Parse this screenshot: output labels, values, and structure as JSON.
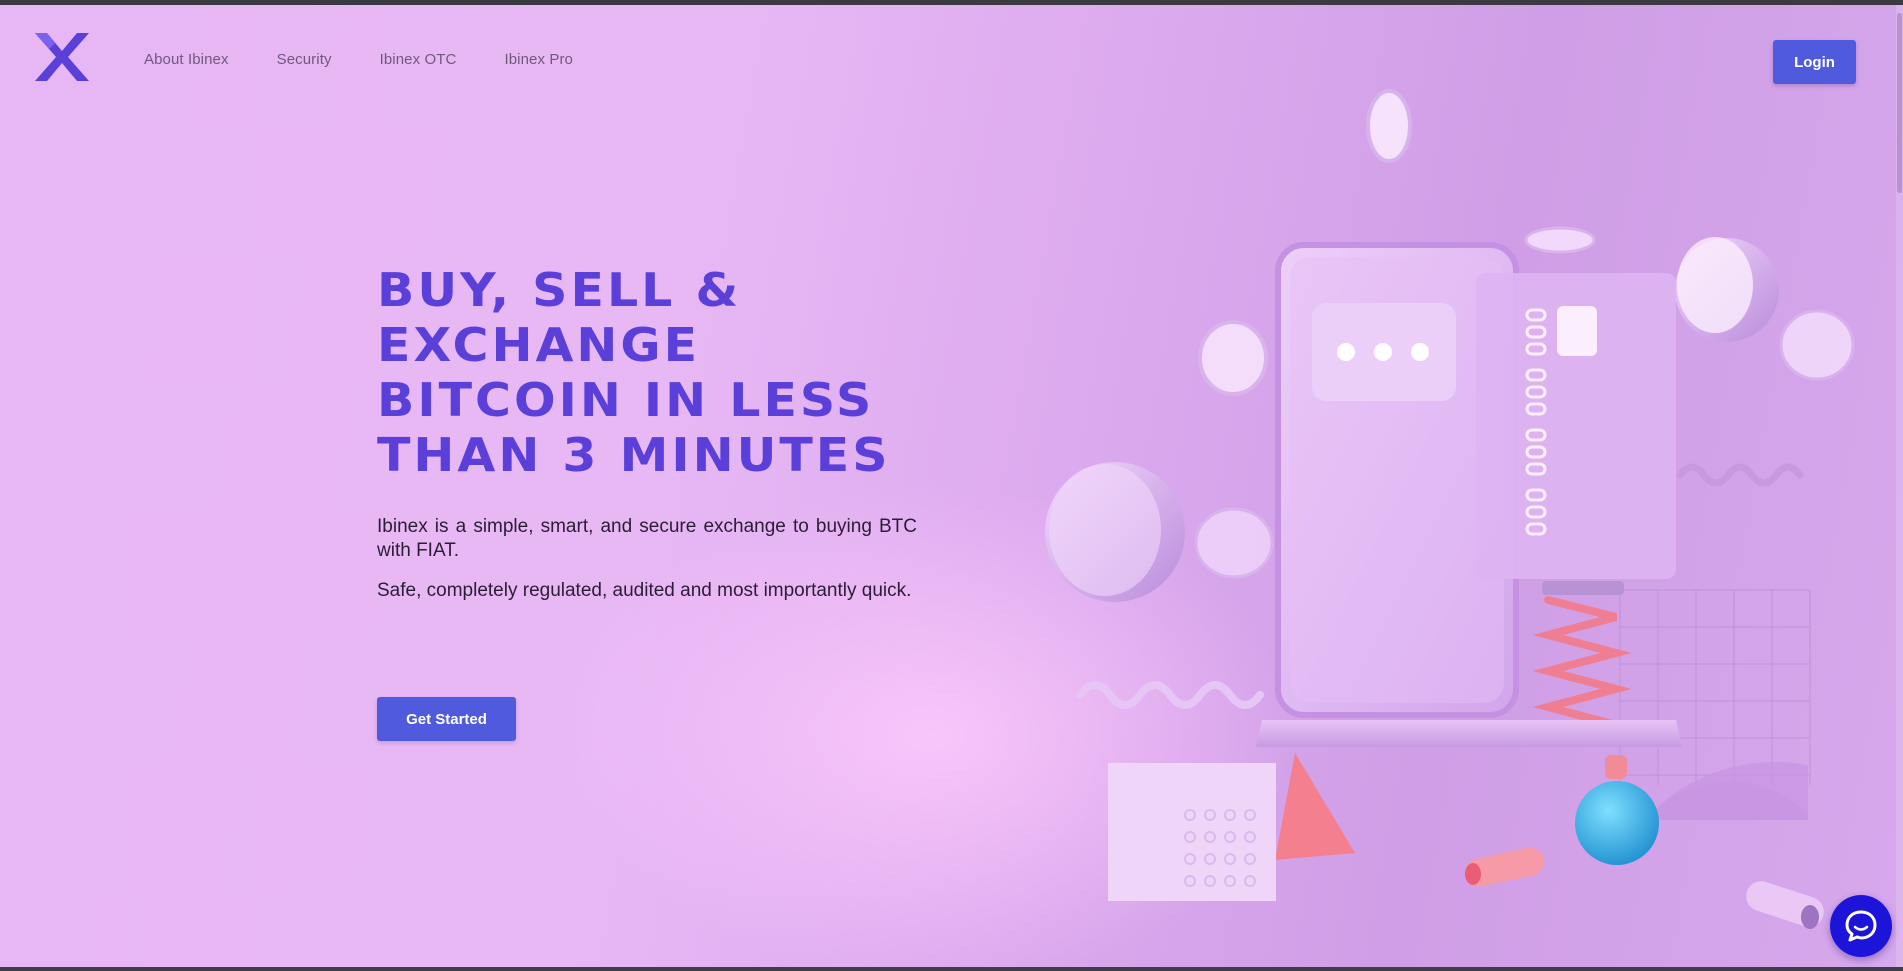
{
  "brand": {
    "name": "Ibinex",
    "accent": "#5a3fd8",
    "button": "#4f5bdc"
  },
  "nav": {
    "items": [
      {
        "label": "About Ibinex"
      },
      {
        "label": "Security"
      },
      {
        "label": "Ibinex OTC"
      },
      {
        "label": "Ibinex Pro"
      }
    ]
  },
  "header": {
    "login_label": "Login"
  },
  "hero": {
    "headline_lines": [
      "BUY, SELL &",
      "EXCHANGE",
      "BITCOIN IN LESS",
      "THAN 3 MINUTES"
    ],
    "paragraph1": "Ibinex is a simple, smart, and secure  exchange to buying BTC with FIAT.",
    "paragraph2": "Safe, completely regulated, audited and most importantly quick.",
    "cta_label": "Get Started"
  },
  "icons": {
    "logo": "ibinex-x-logo",
    "chat": "chat-bubble-icon",
    "illustration": "3d-phone-card-illustration"
  }
}
